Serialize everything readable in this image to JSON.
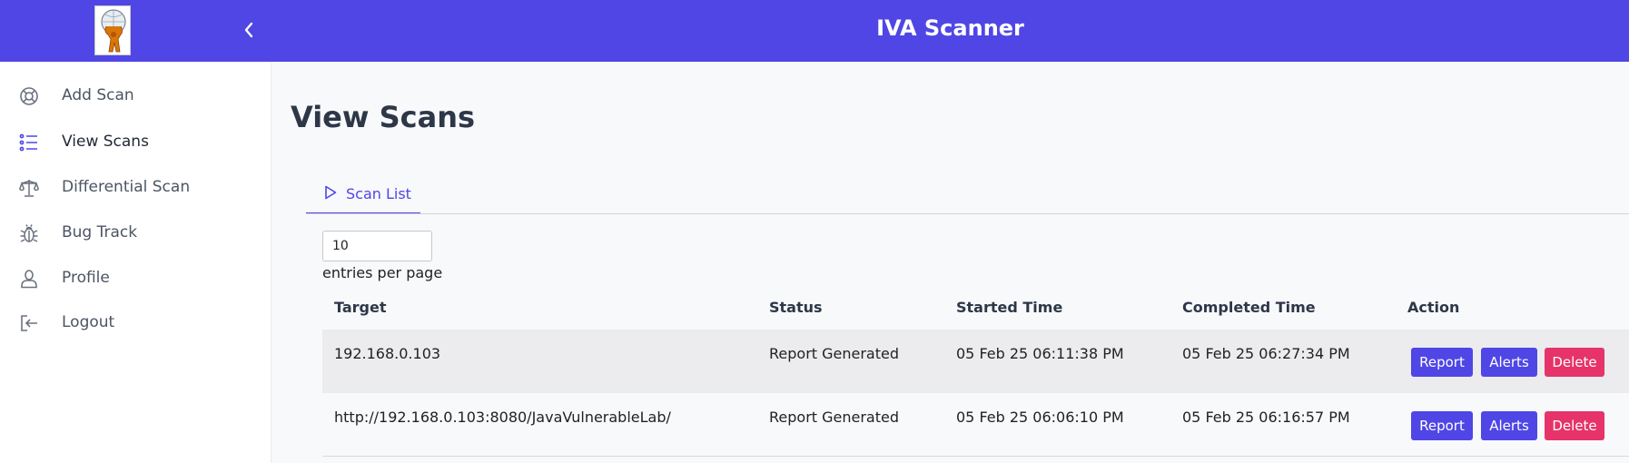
{
  "app": {
    "title": "IVA Scanner"
  },
  "sidebar": {
    "items": [
      {
        "label": "Add Scan",
        "icon": "lifebuoy-icon"
      },
      {
        "label": "View Scans",
        "icon": "list-icon"
      },
      {
        "label": "Differential Scan",
        "icon": "scale-icon"
      },
      {
        "label": "Bug Track",
        "icon": "bug-icon"
      },
      {
        "label": "Profile",
        "icon": "user-icon"
      },
      {
        "label": "Logout",
        "icon": "logout-icon"
      }
    ],
    "active": "View Scans"
  },
  "main": {
    "page_title": "View Scans",
    "tabs": [
      {
        "label": "Scan List",
        "icon": "play-icon"
      }
    ],
    "entries_per_page": {
      "value": "10",
      "label": "entries per page"
    },
    "table": {
      "headers": [
        "Target",
        "Status",
        "Started Time",
        "Completed Time",
        "Action"
      ],
      "rows": [
        {
          "target": "192.168.0.103",
          "status": "Report Generated",
          "started": "05 Feb 25 06:11:38 PM",
          "completed": "05 Feb 25 06:27:34 PM"
        },
        {
          "target": "http://192.168.0.103:8080/JavaVulnerableLab/",
          "status": "Report Generated",
          "started": "05 Feb 25 06:06:10 PM",
          "completed": "05 Feb 25 06:16:57 PM"
        }
      ],
      "actions": {
        "report": "Report",
        "alerts": "Alerts",
        "delete": "Delete"
      }
    }
  },
  "colors": {
    "primary": "#4f46e5",
    "danger": "#e6336a",
    "background": "#f8f9fb"
  }
}
